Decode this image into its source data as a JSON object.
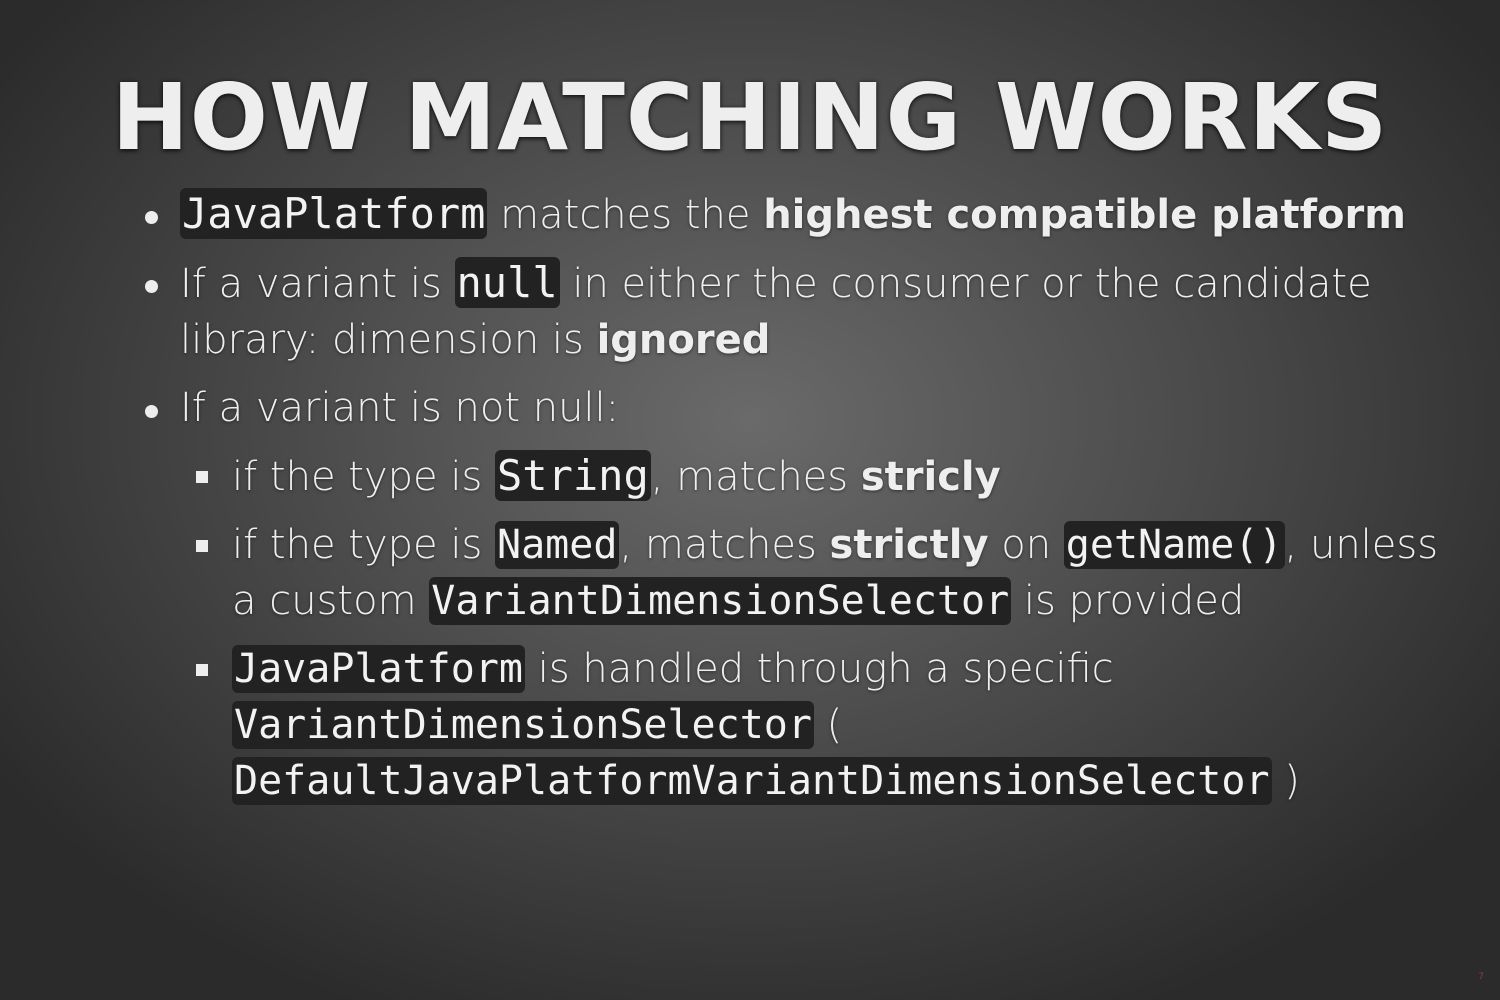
{
  "slide": {
    "title": "HOW MATCHING WORKS",
    "bullets": [
      {
        "code": "JavaPlatform",
        "text1": " matches the ",
        "bold": "highest compatible platform"
      },
      {
        "text1": "If a variant is ",
        "code": "null",
        "text2": " in either the consumer or the candidate library: dimension is ",
        "bold": "ignored"
      },
      {
        "text1": "If a variant is not null:",
        "sub": [
          {
            "text1": "if the type is ",
            "code": "String",
            "text2": ", matches ",
            "bold": "stricly"
          },
          {
            "text1": "if the type is ",
            "code": "Named",
            "text2": ", matches ",
            "bold": "strictly",
            "text3": " on ",
            "code2": "getName()",
            "text4": ", unless a custom ",
            "code3": "VariantDimensionSelector",
            "text5": " is provided"
          },
          {
            "code": "JavaPlatform",
            "text1": " is handled through a specific ",
            "code2": "VariantDimensionSelector",
            "text2": " ( ",
            "code3": "DefaultJavaPlatformVariantDimensionSelector",
            "text3": " )"
          }
        ]
      }
    ],
    "slide_number": "7"
  }
}
